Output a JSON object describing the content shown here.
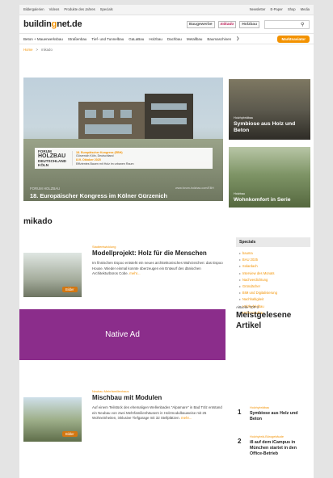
{
  "topbar": {
    "left_links": [
      "Bildergalerien",
      "Videos",
      "Produkte des Jahres",
      "Specials"
    ],
    "right_links": [
      "Newsletter",
      "E-Paper",
      "Shop",
      "Media"
    ]
  },
  "header": {
    "logo_part1": "buildin",
    "logo_accent": "g",
    "logo_part2": "net.de",
    "publications": [
      "Baugewerbe",
      "mikado",
      "Holzbau"
    ],
    "search_placeholder": "",
    "search_icon": "search-icon"
  },
  "nav": {
    "items": [
      "Beton + Mauerwerksbau",
      "Straßenbau",
      "Tief- und Tunnelbau",
      "GaLaBau",
      "Holzbau",
      "Dachbau",
      "Metallbau",
      "Baumaschinen"
    ],
    "more_icon": "chevron-right-icon",
    "highlight": "Marktnaviator"
  },
  "breadcrumb": {
    "home": "Home",
    "separator": ">",
    "current": "mikado"
  },
  "hero": {
    "forum_line1": "FORUM",
    "forum_line2": "HOLZBAU",
    "forum_line3": "DEUTSCHLAND",
    "forum_line4": "KÖLN",
    "banner_line1": "18. Europäischer Kongress (EBH)",
    "banner_line2": "Gürzenich Köln, Deutschland",
    "banner_line3": "8./9. Oktober 2025",
    "banner_line4": "Effizientes Bauen mit Holz im urbanen Raum",
    "url": "www.forum-holzbau.com/EBH",
    "kicker": "FORUM HOLZBAU",
    "title": "18. Europäischer Kongress im Kölner Gürzenich"
  },
  "tiles": [
    {
      "kicker": "Holzhybridbau",
      "title": "Symbiose aus Holz und Beton"
    },
    {
      "kicker": "Holzbau",
      "title": "Wohnkomfort in Serie"
    }
  ],
  "section_title": "mikado",
  "articles": [
    {
      "category": "Stadtentwicklung",
      "title": "Modellprojekt: Holz für die Menschen",
      "excerpt": "Im finnischen Espoo entsteht ein neues architektonisches Wahrzeichen: das Espoo House. Wieder einmal konnte überzeugen ein Entwurf des dänischen Architekturbüros Cobe.",
      "more": "mehr...",
      "badge": "Bilder"
    },
    {
      "category": "Neubau Mehrfamilienhaus",
      "title": "Mischbau mit Modulen",
      "excerpt": "Auf einem Teilstück des ehemaligen Wellenbades \"Alpamare\" in Bad Tölz entstand ein Neubau von zwei Mehrfamilienhäusern in Holzmodulbauweise mit 25 Wohneinheiten, inklusive Tiefgarage mit 32 Stellplätzen.",
      "more": "mehr...",
      "badge": "Bilder"
    }
  ],
  "native_ad": "Native Ad",
  "specials": {
    "heading": "Specials",
    "items": [
      "bauma",
      "BAU 2025",
      "Solardach",
      "Interview des Monats",
      "Nachverdichtung",
      "Gründächer",
      "BIM und Digitalisierung",
      "Nachhaltigkeit",
      "Holzhybridbau",
      "Holzmodulbau"
    ]
  },
  "top3": {
    "subtitle": "Aktuelle TOP 3",
    "title_line1": "Meistgelesene",
    "title_line2": "Artikel",
    "items": [
      {
        "number": "1",
        "kicker": "Holzhybridbau",
        "title": "Symbiose aus Holz und Beton"
      },
      {
        "number": "2",
        "kicker": "Holzhybrid-Bürogebäude",
        "title": "i8 auf dem iCampus in München startet in den Office-Betrieb"
      }
    ]
  },
  "colors": {
    "accent": "#f39200",
    "native_ad_bg": "#8b2d8b",
    "page_bg": "#e4e4e4"
  }
}
